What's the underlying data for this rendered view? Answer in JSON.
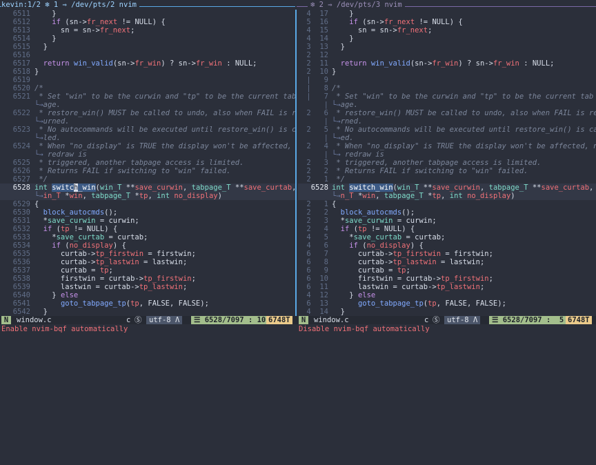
{
  "topbar": {
    "left_title": "kevin:1/2 ❄ 1 ⇒ /dev/pts/2 nvim",
    "right_title": "❄ 2 ⇒ /dev/pts/3 nvim",
    "left_icon": "terminal-icon",
    "right_icon": "terminal-icon"
  },
  "left_pane": {
    "lines": [
      {
        "n": "6511",
        "html": "    }"
      },
      {
        "n": "6512",
        "html": "    <span class='kw'>if</span> (sn-><span class='fd'>fr_next</span> != NULL) {"
      },
      {
        "n": "6513",
        "html": "      sn = sn-><span class='fd'>fr_next</span>;"
      },
      {
        "n": "6514",
        "html": "    }"
      },
      {
        "n": "6515",
        "html": "  }"
      },
      {
        "n": "6516",
        "html": ""
      },
      {
        "n": "6517",
        "html": "  <span class='kw'>return</span> <span class='fn'>win_valid</span>(sn-><span class='fd'>fr_win</span>) ? sn-><span class='fd'>fr_win</span> : NULL;"
      },
      {
        "n": "6518",
        "html": "}"
      },
      {
        "n": "6519",
        "html": ""
      },
      {
        "n": "6520",
        "html": "<span class='cm'>/*</span>"
      },
      {
        "n": "6521",
        "html": "<span class='cm'> * Set \"win\" to be the curwin and \"tp\" to be the current tab p</span>"
      },
      {
        "n": "",
        "html": "<span class='wrapmark'>└→</span><span class='cm'>age.</span>",
        "wrap": true
      },
      {
        "n": "6522",
        "html": "<span class='cm'> * restore_win() MUST be called to undo, also when FAIL is ret</span>"
      },
      {
        "n": "",
        "html": "<span class='wrapmark'>└→</span><span class='cm'>urned.</span>",
        "wrap": true
      },
      {
        "n": "6523",
        "html": "<span class='cm'> * No autocommands will be executed until restore_win() is cal</span>"
      },
      {
        "n": "",
        "html": "<span class='wrapmark'>└→</span><span class='cm'>led.</span>",
        "wrap": true
      },
      {
        "n": "6524",
        "html": "<span class='cm'> * When \"no_display\" is TRUE the display won't be affected, no</span>"
      },
      {
        "n": "",
        "html": "<span class='wrapmark'>└→</span><span class='cm'> redraw is</span>",
        "wrap": true
      },
      {
        "n": "6525",
        "html": "<span class='cm'> * triggered, another tabpage access is limited.</span>"
      },
      {
        "n": "6526",
        "html": "<span class='cm'> * Returns FAIL if switching to \"win\" failed.</span>"
      },
      {
        "n": "6527",
        "html": "<span class='cm'> */</span>"
      },
      {
        "n": "6528",
        "html": "<span class='ty'>int</span> <span class='sel'>switc<span class='cursor'>h</span>_win</span>(<span class='ty'>win_T</span> **<span class='fd'>save_curwin</span>, <span class='ty'>tabpage_T</span> **<span class='fd'>save_curtab</span>, w",
        "cur": true
      },
      {
        "n": "",
        "html": "<span class='wrapmark'>└→</span><span class='fd'>in_T</span> *<span class='fd'>win</span>, <span class='ty'>tabpage_T</span> *<span class='fd'>tp</span>, <span class='ty'>int</span> <span class='fd'>no_display</span>)",
        "wrap": true,
        "cur": true
      },
      {
        "n": "6529",
        "html": "{"
      },
      {
        "n": "6530",
        "html": "  <span class='fn'>block_autocmds</span>();"
      },
      {
        "n": "6531",
        "html": "  *<span class='ty'>save_curwin</span> = curwin;"
      },
      {
        "n": "6532",
        "html": "  <span class='kw'>if</span> (<span class='fd'>tp</span> != NULL) {"
      },
      {
        "n": "6533",
        "html": "    *<span class='ty'>save_curtab</span> = curtab;"
      },
      {
        "n": "6534",
        "html": "    <span class='kw'>if</span> (<span class='fd'>no_display</span>) {"
      },
      {
        "n": "6535",
        "html": "      curtab-><span class='fd'>tp_firstwin</span> = firstwin;"
      },
      {
        "n": "6536",
        "html": "      curtab-><span class='fd'>tp_lastwin</span> = lastwin;"
      },
      {
        "n": "6537",
        "html": "      curtab = <span class='fd'>tp</span>;"
      },
      {
        "n": "6538",
        "html": "      firstwin = curtab-><span class='fd'>tp_firstwin</span>;"
      },
      {
        "n": "6539",
        "html": "      lastwin = curtab-><span class='fd'>tp_lastwin</span>;"
      },
      {
        "n": "6540",
        "html": "    } <span class='kw'>else</span>"
      },
      {
        "n": "6541",
        "html": "      <span class='fn'>goto_tabpage_tp</span>(<span class='fd'>tp</span>, FALSE, FALSE);"
      },
      {
        "n": "6542",
        "html": "  }"
      }
    ]
  },
  "right_pane": {
    "lines": [
      {
        "n": "4  17",
        "html": "    }"
      },
      {
        "n": "5  16",
        "html": "    <span class='kw'>if</span> (sn-><span class='fd'>fr_next</span> != NULL) {"
      },
      {
        "n": "4  15",
        "html": "      sn = sn-><span class='fd'>fr_next</span>;"
      },
      {
        "n": "4  14",
        "html": "    }"
      },
      {
        "n": "3  13",
        "html": "  }"
      },
      {
        "n": "2  12",
        "html": ""
      },
      {
        "n": "2  11",
        "html": "  <span class='kw'>return</span> <span class='fn'>win_valid</span>(sn-><span class='fd'>fr_win</span>) ? sn-><span class='fd'>fr_win</span> : NULL;"
      },
      {
        "n": "2  10",
        "html": "}"
      },
      {
        "n": "|   9",
        "html": ""
      },
      {
        "n": "|   8",
        "html": "<span class='cm'>/*</span>"
      },
      {
        "n": "|   7",
        "html": "<span class='cm'> * Set \"win\" to be the curwin and \"tp\" to be the current tab p</span>"
      },
      {
        "n": "|",
        "html": "<span class='wrapmark'>└→</span><span class='cm'>age.</span>",
        "wrap": true
      },
      {
        "n": "2   6",
        "html": "<span class='cm'> * restore_win() MUST be called to undo, also when FAIL is retu</span>"
      },
      {
        "n": "|",
        "html": "<span class='wrapmark'>└→</span><span class='cm'>rned.</span>",
        "wrap": true
      },
      {
        "n": "2   5",
        "html": "<span class='cm'> * No autocommands will be executed until restore_win() is call</span>"
      },
      {
        "n": "|",
        "html": "<span class='wrapmark'>└→</span><span class='cm'>ed.</span>",
        "wrap": true
      },
      {
        "n": "2   4",
        "html": "<span class='cm'> * When \"no_display\" is TRUE the display won't be affected, no</span>"
      },
      {
        "n": "|",
        "html": "<span class='wrapmark'>└→</span><span class='cm'> redraw is</span>",
        "wrap": true
      },
      {
        "n": "2   3",
        "html": "<span class='cm'> * triggered, another tabpage access is limited.</span>"
      },
      {
        "n": "2   2",
        "html": "<span class='cm'> * Returns FAIL if switching to \"win\" failed.</span>"
      },
      {
        "n": "2   1",
        "html": "<span class='cm'> */</span>"
      },
      {
        "n": "6528",
        "html": "<span class='ty'>int</span> <span class='sel'>switch_win</span>(<span class='ty'>win_T</span> **<span class='fd'>save_curwin</span>, <span class='ty'>tabpage_T</span> **<span class='fd'>save_curtab</span>, wi",
        "cur": true
      },
      {
        "n": "",
        "html": "<span class='wrapmark'>└→</span><span class='fd'>n_T</span> *<span class='fd'>win</span>, <span class='ty'>tabpage_T</span> *<span class='fd'>tp</span>, <span class='ty'>int</span> <span class='fd'>no_display</span>)",
        "wrap": true,
        "cur": true
      },
      {
        "n": "2   1",
        "html": "{"
      },
      {
        "n": "2   2",
        "html": "  <span class='fn'>block_autocmds</span>();"
      },
      {
        "n": "2   3",
        "html": "  *<span class='ty'>save_curwin</span> = curwin;"
      },
      {
        "n": "2   4",
        "html": "  <span class='kw'>if</span> (<span class='fd'>tp</span> != NULL) {"
      },
      {
        "n": "4   5",
        "html": "    *<span class='ty'>save_curtab</span> = curtab;"
      },
      {
        "n": "4   6",
        "html": "    <span class='kw'>if</span> (<span class='fd'>no_display</span>) {"
      },
      {
        "n": "6   7",
        "html": "      curtab-><span class='fd'>tp_firstwin</span> = firstwin;"
      },
      {
        "n": "6   8",
        "html": "      curtab-><span class='fd'>tp_lastwin</span> = lastwin;"
      },
      {
        "n": "6   9",
        "html": "      curtab = <span class='fd'>tp</span>;"
      },
      {
        "n": "6  10",
        "html": "      firstwin = curtab-><span class='fd'>tp_firstwin</span>;"
      },
      {
        "n": "6  11",
        "html": "      lastwin = curtab-><span class='fd'>tp_lastwin</span>;"
      },
      {
        "n": "4  12",
        "html": "    } <span class='kw'>else</span>"
      },
      {
        "n": "6  13",
        "html": "      <span class='fn'>goto_tabpage_tp</span>(<span class='fd'>tp</span>, FALSE, FALSE);"
      },
      {
        "n": "4  14",
        "html": "  }"
      }
    ]
  },
  "statusline_left": {
    "mode": "N",
    "file": "window.c",
    "filetype": "c",
    "filetype_icon": "c-language-icon",
    "encoding": "utf-8",
    "encoding_icon": "linux-icon",
    "position": "☰ 6528/7097 : 10",
    "words": "6748T"
  },
  "statusline_right": {
    "mode": "N",
    "file": "window.c",
    "filetype": "c",
    "filetype_icon": "c-language-icon",
    "encoding": "utf-8",
    "encoding_icon": "linux-icon",
    "position": "☰ 6528/7097 :  5",
    "words": "6748T"
  },
  "cmdline": {
    "left_message": "Enable nvim-bqf automatically",
    "right_message": "Disable nvim-bqf automatically"
  },
  "colors": {
    "left_accent": "#5aa9e6",
    "right_accent": "#7a6aa6",
    "mode_bg": "#a3be8c",
    "words_bg": "#ebcb8b"
  }
}
